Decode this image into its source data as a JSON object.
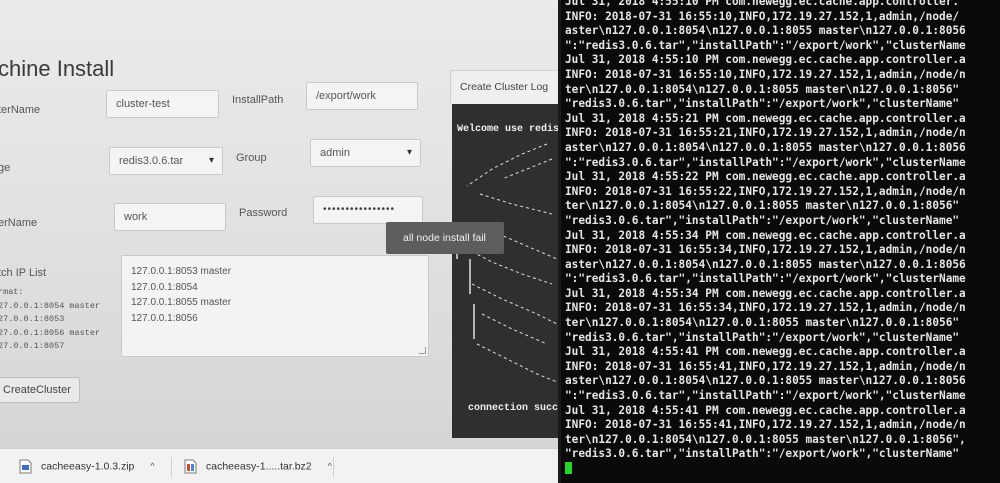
{
  "page": {
    "title": "chine Install"
  },
  "form": {
    "cluster_name": {
      "label": "terName",
      "value": "cluster-test"
    },
    "install_path": {
      "label": "InstallPath",
      "value": "/export/work"
    },
    "image": {
      "label": "ge",
      "value": "redis3.0.6.tar"
    },
    "group": {
      "label": "Group",
      "value": "admin"
    },
    "user_name": {
      "label": "erName",
      "value": "work"
    },
    "password": {
      "label": "Password",
      "value": "••••••••••••••••"
    },
    "ip_list": {
      "label": "tch IP List",
      "format_hint": "rmat:\n27.0.0.1:8054 master\n27.0.0.1:8053\n27.0.0.1:8056 master\n27.0.0.1:8057",
      "lines": [
        "127.0.0.1:8053 master",
        "127.0.0.1:8054",
        "127.0.0.1:8055 master",
        "127.0.0.1:8056"
      ]
    },
    "create_button": "CreateCluster"
  },
  "tooltip": "all node install fail",
  "log_panel": {
    "tab_label": "Create Cluster Log",
    "welcome": "Welcome use redis",
    "status": "connection success"
  },
  "downloads": [
    {
      "name": "cacheeasy-1.0.3.zip",
      "icon": "zip-file-icon"
    },
    {
      "name": "cacheeasy-1.....tar.bz2",
      "icon": "archive-file-icon"
    }
  ],
  "terminal": {
    "cursor_color": "#27d52a",
    "lines": [
      "Jul 31, 2018 4:55:10 PM com.newegg.ec.cache.app.controller.",
      "INFO: 2018-07-31 16:55:10,INFO,172.19.27.152,1,admin,/node/",
      "aster\\n127.0.0.1:8054\\n127.0.0.1:8055 master\\n127.0.0.1:8056",
      "\":\"redis3.0.6.tar\",\"installPath\":\"/export/work\",\"clusterName",
      "Jul 31, 2018 4:55:10 PM com.newegg.ec.cache.app.controller.a",
      "INFO: 2018-07-31 16:55:10,INFO,172.19.27.152,1,admin,/node/n",
      "ter\\n127.0.0.1:8054\\n127.0.0.1:8055 master\\n127.0.0.1:8056\"",
      "\"redis3.0.6.tar\",\"installPath\":\"/export/work\",\"clusterName\"",
      "Jul 31, 2018 4:55:21 PM com.newegg.ec.cache.app.controller.a",
      "INFO: 2018-07-31 16:55:21,INFO,172.19.27.152,1,admin,/node/n",
      "aster\\n127.0.0.1:8054\\n127.0.0.1:8055 master\\n127.0.0.1:8056",
      "\":\"redis3.0.6.tar\",\"installPath\":\"/export/work\",\"clusterName",
      "Jul 31, 2018 4:55:22 PM com.newegg.ec.cache.app.controller.a",
      "INFO: 2018-07-31 16:55:22,INFO,172.19.27.152,1,admin,/node/n",
      "ter\\n127.0.0.1:8054\\n127.0.0.1:8055 master\\n127.0.0.1:8056\"",
      "\"redis3.0.6.tar\",\"installPath\":\"/export/work\",\"clusterName\"",
      "Jul 31, 2018 4:55:34 PM com.newegg.ec.cache.app.controller.a",
      "INFO: 2018-07-31 16:55:34,INFO,172.19.27.152,1,admin,/node/n",
      "aster\\n127.0.0.1:8054\\n127.0.0.1:8055 master\\n127.0.0.1:8056",
      "\":\"redis3.0.6.tar\",\"installPath\":\"/export/work\",\"clusterName",
      "Jul 31, 2018 4:55:34 PM com.newegg.ec.cache.app.controller.a",
      "INFO: 2018-07-31 16:55:34,INFO,172.19.27.152,1,admin,/node/n",
      "ter\\n127.0.0.1:8054\\n127.0.0.1:8055 master\\n127.0.0.1:8056\"",
      "\"redis3.0.6.tar\",\"installPath\":\"/export/work\",\"clusterName\"",
      "Jul 31, 2018 4:55:41 PM com.newegg.ec.cache.app.controller.a",
      "INFO: 2018-07-31 16:55:41,INFO,172.19.27.152,1,admin,/node/n",
      "aster\\n127.0.0.1:8054\\n127.0.0.1:8055 master\\n127.0.0.1:8056",
      "\":\"redis3.0.6.tar\",\"installPath\":\"/export/work\",\"clusterName",
      "Jul 31, 2018 4:55:41 PM com.newegg.ec.cache.app.controller.a",
      "INFO: 2018-07-31 16:55:41,INFO,172.19.27.152,1,admin,/node/n",
      "ter\\n127.0.0.1:8054\\n127.0.0.1:8055 master\\n127.0.0.1:8056\",",
      "\"redis3.0.6.tar\",\"installPath\":\"/export/work\",\"clusterName\""
    ]
  }
}
